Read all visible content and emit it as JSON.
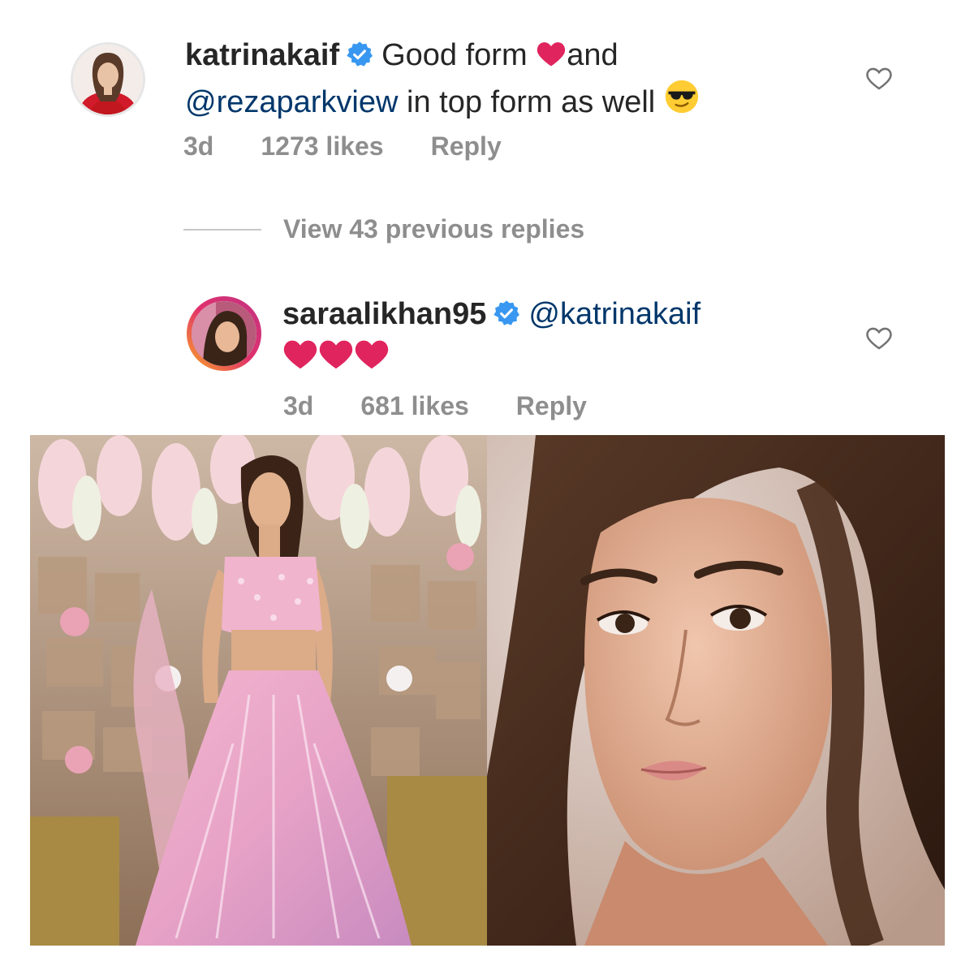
{
  "comment1": {
    "username": "katrinakaif",
    "text_part1": "Good form",
    "text_part2": "and",
    "mention": "@rezaparkview",
    "text_part3": "in top form as well",
    "time": "3d",
    "likes": "1273 likes",
    "reply": "Reply",
    "emoji_icons": [
      "heart-emoji",
      "sunglasses-emoji"
    ]
  },
  "view_replies": "View 43 previous replies",
  "comment2": {
    "username": "saraalikhan95",
    "mention": "@katrinakaif",
    "time": "3d",
    "likes": "681 likes",
    "reply": "Reply",
    "emoji_icons": [
      "heart-emoji",
      "heart-emoji",
      "heart-emoji"
    ]
  },
  "colors": {
    "text": "#262626",
    "muted": "#8e8e8e",
    "mention": "#00376b",
    "verified": "#3897f0",
    "heart": "#e0245e"
  }
}
